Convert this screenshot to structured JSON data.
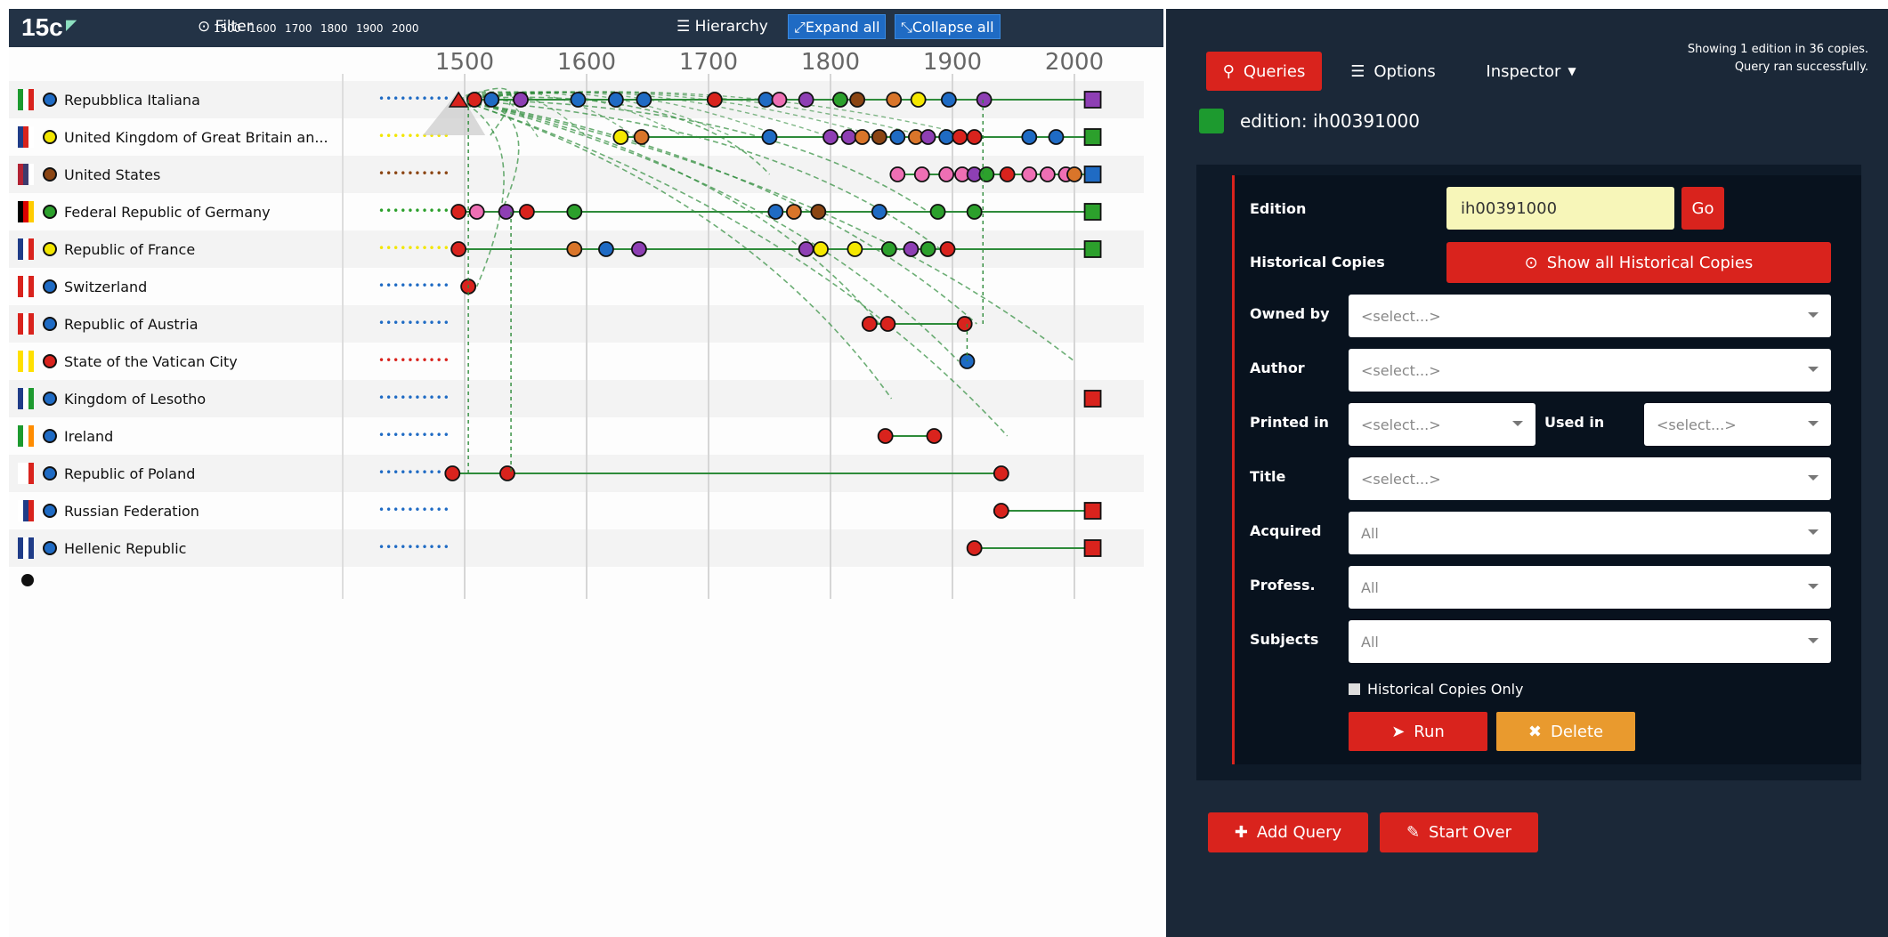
{
  "app": {
    "logo": "15c"
  },
  "toolbar": {
    "filter_label": "Filter",
    "year_ticks": [
      "1500",
      "1600",
      "1700",
      "1800",
      "1900",
      "2000"
    ],
    "hierarchy_label": "Hierarchy",
    "expand_label": "Expand all",
    "collapse_label": "Collapse all"
  },
  "timeline": {
    "axis_labels": [
      "1500",
      "1600",
      "1700",
      "1800",
      "1900",
      "2000"
    ],
    "countries": [
      {
        "name": "Repubblica Italiana",
        "dot_color": "#1f6bc4",
        "dots_color": "#1f6bc4"
      },
      {
        "name": "United Kingdom of Great Britain an...",
        "dot_color": "#f2e600",
        "dots_color": "#f2e600"
      },
      {
        "name": "United States",
        "dot_color": "#8b4513",
        "dots_color": "#8b4513"
      },
      {
        "name": "Federal Republic of Germany",
        "dot_color": "#2ca02c",
        "dots_color": "#2ca02c"
      },
      {
        "name": "Republic of France",
        "dot_color": "#f2e600",
        "dots_color": "#f2e600"
      },
      {
        "name": "Switzerland",
        "dot_color": "#1f6bc4",
        "dots_color": "#1f6bc4"
      },
      {
        "name": "Republic of Austria",
        "dot_color": "#1f6bc4",
        "dots_color": "#1f6bc4"
      },
      {
        "name": "State of the Vatican City",
        "dot_color": "#d9231d",
        "dots_color": "#d9231d"
      },
      {
        "name": "Kingdom of Lesotho",
        "dot_color": "#1f6bc4",
        "dots_color": "#1f6bc4"
      },
      {
        "name": "Ireland",
        "dot_color": "#1f6bc4",
        "dots_color": "#1f6bc4"
      },
      {
        "name": "Republic of Poland",
        "dot_color": "#1f6bc4",
        "dots_color": "#1f6bc4"
      },
      {
        "name": "Russian Federation",
        "dot_color": "#1f6bc4",
        "dots_color": "#1f6bc4"
      },
      {
        "name": "Hellenic Republic",
        "dot_color": "#1f6bc4",
        "dots_color": "#1f6bc4"
      }
    ]
  },
  "panel": {
    "tabs": {
      "queries": "Queries",
      "options": "Options",
      "inspector": "Inspector"
    },
    "status_line1": "Showing 1 edition in 36 copies.",
    "status_line2": "Query ran successfully.",
    "edition_title": "edition: ih00391000",
    "query": {
      "edition_label": "Edition",
      "edition_value": "ih00391000",
      "go_label": "Go",
      "historical_label": "Historical Copies",
      "show_all_label": "Show all Historical Copies",
      "owned_by_label": "Owned by",
      "owned_by_value": "<select...>",
      "author_label": "Author",
      "author_value": "<select...>",
      "printed_in_label": "Printed in",
      "printed_in_value": "<select...>",
      "used_in_label": "Used in",
      "used_in_value": "<select...>",
      "title_label": "Title",
      "title_value": "<select...>",
      "acquired_label": "Acquired",
      "acquired_value": "All",
      "profess_label": "Profess.",
      "profess_value": "All",
      "subjects_label": "Subjects",
      "subjects_value": "All",
      "hc_only_label": "Historical Copies Only",
      "run_label": "Run",
      "delete_label": "Delete"
    },
    "add_query_label": "Add Query",
    "start_over_label": "Start Over"
  }
}
